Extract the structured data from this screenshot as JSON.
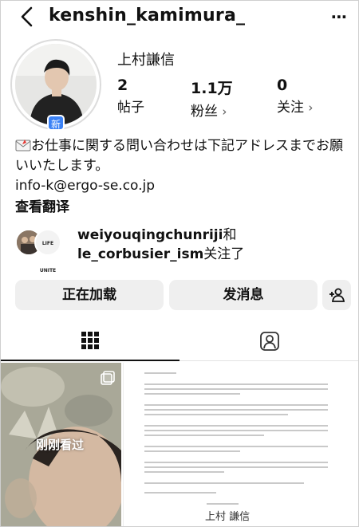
{
  "header": {
    "username": "kenshin_kamimura_",
    "back_icon": "chevron-left-icon",
    "more_icon": "more-dots-icon"
  },
  "profile": {
    "display_name": "上村謙信",
    "new_badge": "新",
    "stats": {
      "posts": {
        "value": "2",
        "label": "帖子"
      },
      "followers": {
        "value": "1.1万",
        "label": "粉丝",
        "chevron": "›"
      },
      "following": {
        "value": "0",
        "label": "关注",
        "chevron": "›"
      }
    }
  },
  "bio": {
    "emoji_icon": "envelope-icon",
    "line1": "お仕事に関する問い合わせは下記アドレスまでお願いいたします。",
    "email": "info-k@ergo-se.co.jp",
    "translate": "查看翻译"
  },
  "followed_by": {
    "user1": "weiyouqingchunriji",
    "joiner": "和",
    "user2": "le_corbusier_ism",
    "suffix": "关注了",
    "avatar2_text": "LIFE UNITE"
  },
  "buttons": {
    "follow": "正在加载",
    "message": "发消息",
    "add_user_icon": "add-user-icon"
  },
  "tabs": {
    "grid_icon": "grid-icon",
    "tagged_icon": "tagged-person-icon"
  },
  "posts": {
    "first_overlay": "刚刚看过",
    "signature": "上村 謙信"
  }
}
